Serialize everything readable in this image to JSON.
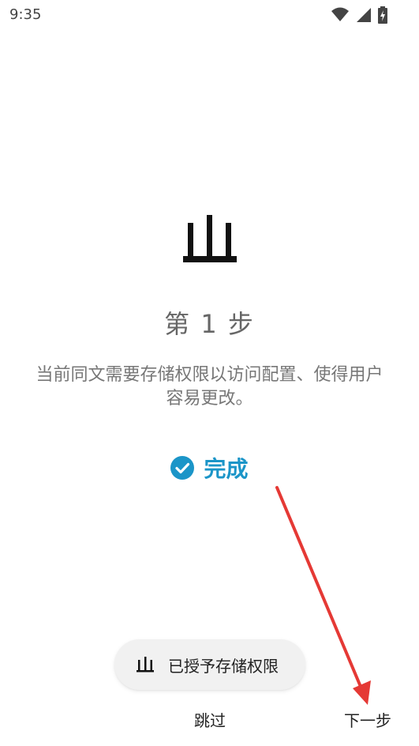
{
  "status_bar": {
    "time": "9:35",
    "icons": [
      "wifi-icon",
      "signal-icon",
      "battery-icon"
    ]
  },
  "main": {
    "hero_icon": "storage-icon",
    "step_title": "第 1 步",
    "description": "当前同文需要存储权限以访问配置、使得用户容易更改。",
    "status": {
      "icon": "check-circle-icon",
      "text": "完成",
      "color": "#1b95c8"
    }
  },
  "permission_chip": {
    "icon": "storage-icon",
    "label": "已授予存储权限"
  },
  "footer": {
    "skip_label": "跳过",
    "next_label": "下一步"
  },
  "annotation": {
    "type": "arrow",
    "color": "#e53935"
  }
}
